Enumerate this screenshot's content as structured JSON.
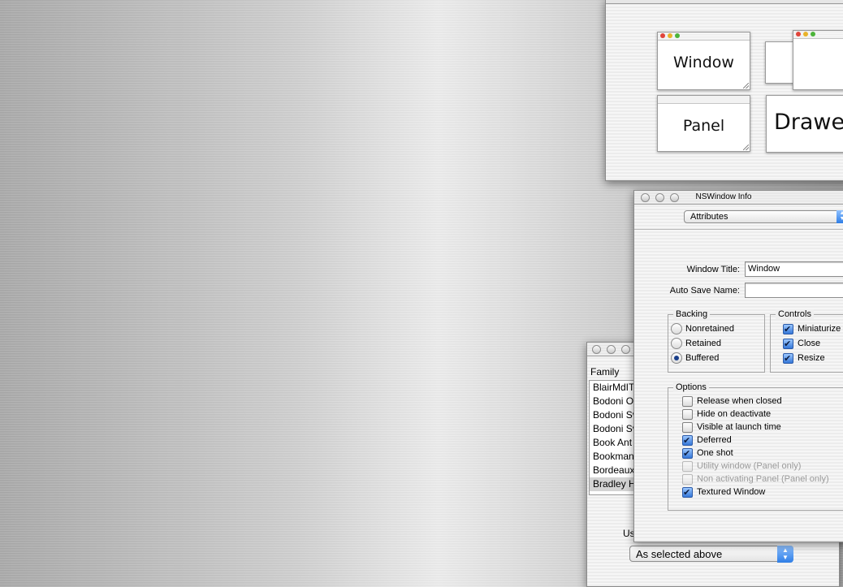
{
  "palette": {
    "tiles": [
      {
        "label": "Window"
      },
      {
        "label": ""
      },
      {
        "label": "Panel"
      },
      {
        "label": "Drawer"
      }
    ]
  },
  "info_panel": {
    "title": "NSWindow Info",
    "section_select": "Attributes",
    "window_title_label": "Window Title:",
    "window_title_value": "Window",
    "auto_save_label": "Auto Save Name:",
    "auto_save_value": "",
    "backing": {
      "title": "Backing",
      "options": [
        {
          "label": "Nonretained",
          "selected": false
        },
        {
          "label": "Retained",
          "selected": false
        },
        {
          "label": "Buffered",
          "selected": true
        }
      ]
    },
    "controls": {
      "title": "Controls",
      "items": [
        {
          "label": "Miniaturize",
          "checked": true
        },
        {
          "label": "Close",
          "checked": true
        },
        {
          "label": "Resize",
          "checked": true
        }
      ]
    },
    "options": {
      "title": "Options",
      "items": [
        {
          "label": "Release when closed",
          "checked": false,
          "enabled": true
        },
        {
          "label": "Hide on deactivate",
          "checked": false,
          "enabled": true
        },
        {
          "label": "Visible at launch time",
          "checked": false,
          "enabled": true
        },
        {
          "label": "Deferred",
          "checked": true,
          "enabled": true
        },
        {
          "label": "One shot",
          "checked": true,
          "enabled": true
        },
        {
          "label": "Utility window (Panel only)",
          "checked": false,
          "enabled": false
        },
        {
          "label": "Non activating Panel (Panel only)",
          "checked": false,
          "enabled": false
        },
        {
          "label": "Textured Window",
          "checked": true,
          "enabled": true
        }
      ]
    }
  },
  "font_panel": {
    "family_header": "Family",
    "families": [
      "BlairMdITC",
      "Bodoni O",
      "Bodoni Sv",
      "Bodoni Sv",
      "Book Ant",
      "Bookman",
      "Bordeaux",
      "Bradley H"
    ],
    "selected_index": 7,
    "use_label": "Use",
    "size_select": "As selected above"
  }
}
